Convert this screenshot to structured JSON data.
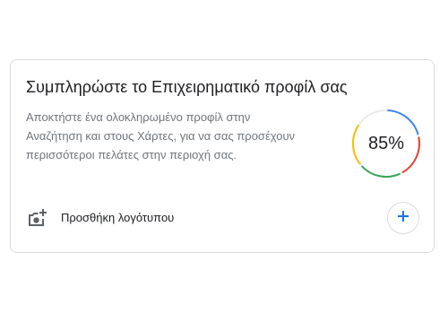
{
  "card": {
    "title": "Συμπληρώστε το Επιχειρηματικό προφίλ σας",
    "description_lines": [
      "Αποκτήστε ένα ολοκληρωμένο προφίλ στην",
      "Αναζήτηση και στους Χάρτες, για να σας προσέχουν",
      "περισσότεροι πελάτες στην περιοχή σας."
    ],
    "progress": {
      "value": 0.85,
      "label": "85%",
      "colors": [
        "#4285f4",
        "#ea4335",
        "#34a853",
        "#fbbc04"
      ]
    },
    "action": {
      "icon": "add-photo-icon",
      "label": "Προσθήκη λογότυπου",
      "button_icon": "plus-icon",
      "accent": "#1a73e8"
    }
  }
}
